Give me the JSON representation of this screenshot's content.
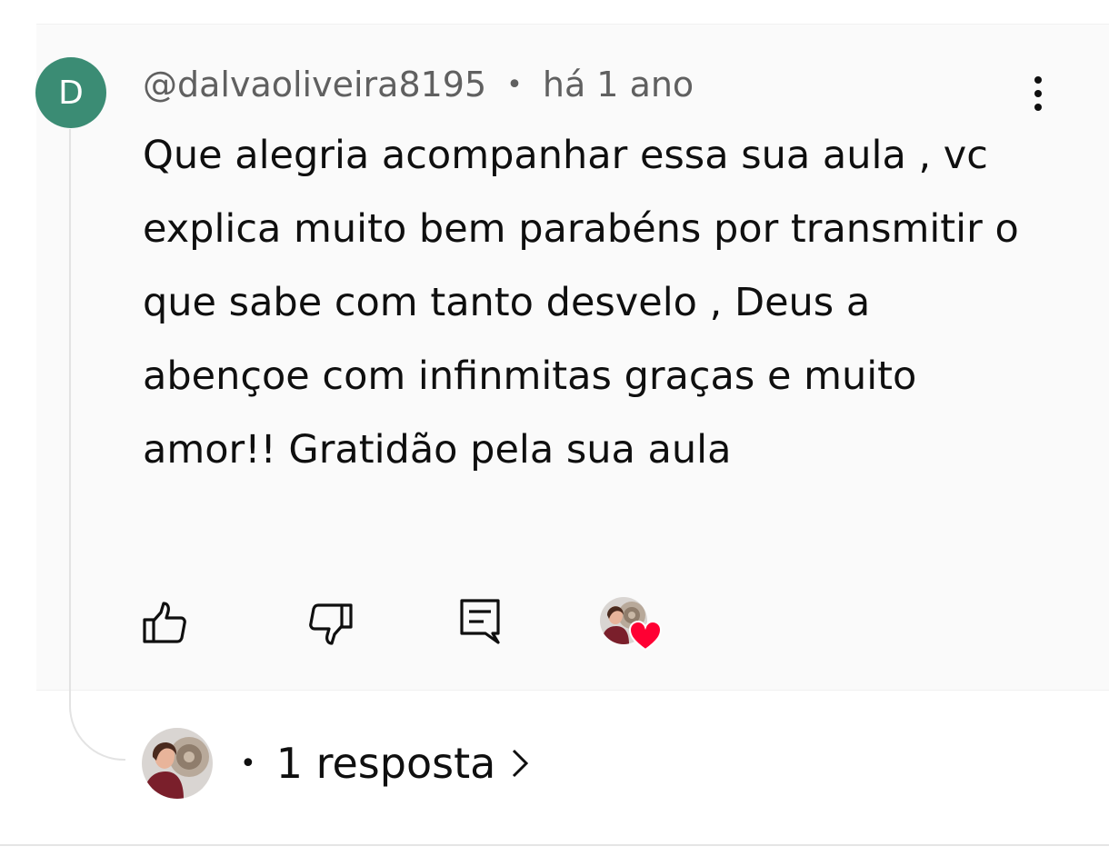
{
  "comment": {
    "avatar_letter": "D",
    "avatar_color": "#3b8c74",
    "author": "@dalvaoliveira8195",
    "separator": "•",
    "time": "há 1 ano",
    "text": "Que alegria acompanhar essa sua aula , vc explica muito bem parabéns por transmitir o que sabe com tanto desvelo , Deus a abençoe com infinmitas graças e muito amor!! Gratidão pela sua aula"
  },
  "actions": {
    "like_icon": "thumbs-up-icon",
    "dislike_icon": "thumbs-down-icon",
    "reply_icon": "comment-icon",
    "creator_heart_icon": "heart-icon",
    "heart_color": "#ff0033"
  },
  "replies": {
    "separator": "•",
    "label": "1 resposta",
    "chevron_icon": "chevron-right-icon"
  }
}
